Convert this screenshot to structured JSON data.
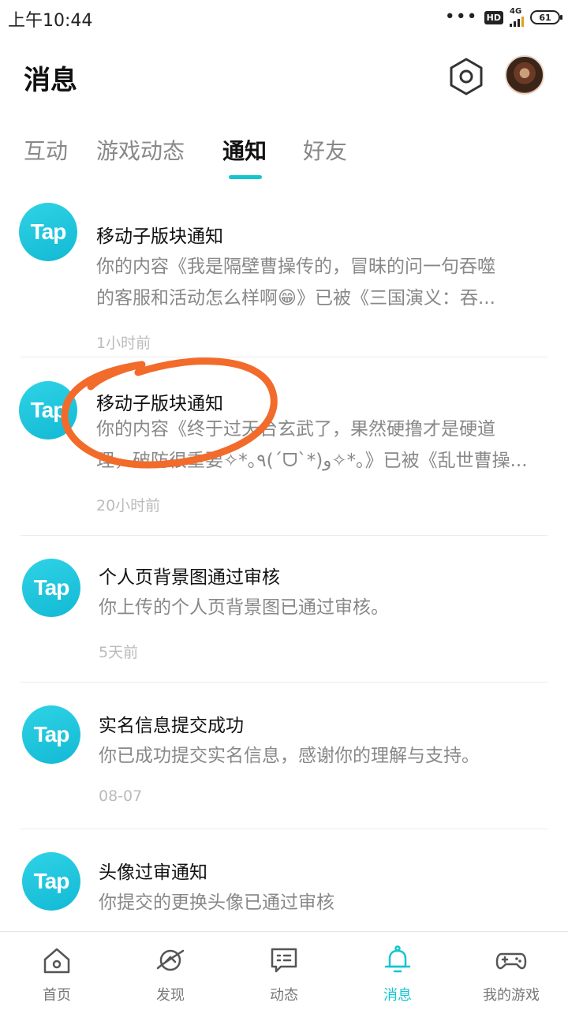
{
  "status_bar": {
    "time": "上午10:44",
    "hd": "HD",
    "network": "4G",
    "battery": "61"
  },
  "header": {
    "title": "消息",
    "settings_icon": "hexagon-settings-icon",
    "avatar_icon": "user-avatar"
  },
  "tabs": [
    {
      "label": "互动",
      "active": false
    },
    {
      "label": "游戏动态",
      "active": false
    },
    {
      "label": "通知",
      "active": true
    },
    {
      "label": "好友",
      "active": false
    }
  ],
  "notifications": [
    {
      "logo": "Tap",
      "title": "移动子版块通知",
      "lines": [
        "你的内容《我是隔壁曹操传的，冒昧的问一句吞噬",
        "的客服和活动怎么样啊😁》已被《三国演义：吞..."
      ],
      "time": "1小时前"
    },
    {
      "logo": "Tap",
      "title": "移动子版块通知",
      "lines": [
        "你的内容《终于过天台玄武了，果然硬撸才是硬道",
        "理，破防很重要✧*｡٩(ˊᗜˋ*)و✧*｡》已被《乱世曹操..."
      ],
      "time": "20小时前"
    },
    {
      "logo": "Tap",
      "title": "个人页背景图通过审核",
      "lines": [
        "你上传的个人页背景图已通过审核。"
      ],
      "time": "5天前"
    },
    {
      "logo": "Tap",
      "title": "实名信息提交成功",
      "lines": [
        "你已成功提交实名信息，感谢你的理解与支持。"
      ],
      "time": "08-07"
    },
    {
      "logo": "Tap",
      "title": "头像过审通知",
      "lines": [
        "你提交的更换头像已通过审核"
      ],
      "time": ""
    }
  ],
  "bottom_nav": [
    {
      "label": "首页",
      "icon": "home-icon",
      "active": false
    },
    {
      "label": "发现",
      "icon": "planet-icon",
      "active": false
    },
    {
      "label": "动态",
      "icon": "chat-icon",
      "active": false
    },
    {
      "label": "消息",
      "icon": "bell-icon",
      "active": true
    },
    {
      "label": "我的游戏",
      "icon": "gamepad-icon",
      "active": false
    }
  ],
  "colors": {
    "accent": "#15c5ce",
    "annotation": "#f26b2a"
  }
}
